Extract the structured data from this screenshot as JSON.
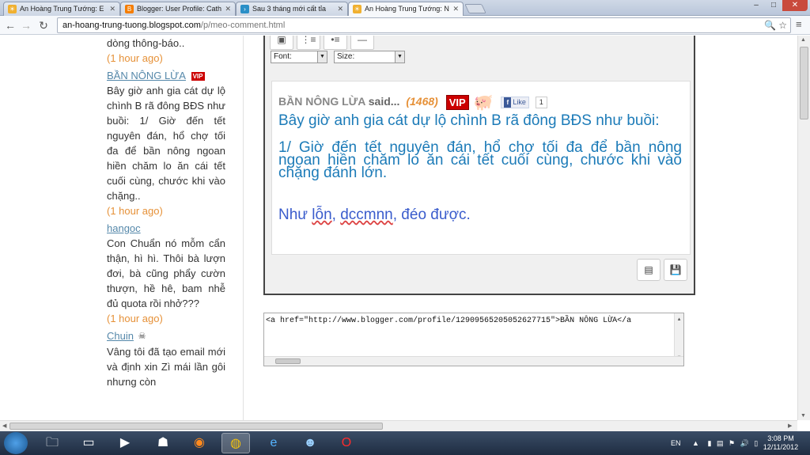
{
  "browser": {
    "tabs": [
      {
        "title": "An Hoàng Trung Tướng: E",
        "icon": "sun-icon",
        "active": false
      },
      {
        "title": "Blogger: User Profile: Cath",
        "icon": "blogger-icon",
        "active": false
      },
      {
        "title": "Sau 3 tháng mới cất tỉa",
        "icon": "arrow-icon",
        "active": false
      },
      {
        "title": "An Hoàng Trung Tướng: N",
        "icon": "sun-icon",
        "active": true
      }
    ],
    "window_controls": {
      "minimize": "–",
      "maximize": "□",
      "close": "✕"
    },
    "url_host": "an-hoang-trung-tuong.blogspot.com",
    "url_path": "/p/meo-comment.html"
  },
  "sidebar": {
    "intro_text": "dòng thông-báo..",
    "intro_time": "(1 hour ago)",
    "comments": [
      {
        "author": "BẦN NÔNG LỪA",
        "badge": "VIP",
        "text": "Bây giờ anh gia cát dự lộ chình B rã đông BĐS như buồi: 1/ Giờ đến tết nguyên đán, hổ chợ tối đa để bần nông ngoan hiền chăm lo ăn cái tết cuối cùng, chước khi vào chặng..",
        "time": "(1 hour ago)"
      },
      {
        "author": "hangoc",
        "badge": "",
        "text": "Con Chuẩn nó mỗm cẩn thận, hì hì. Thôi bà lượn đơi, bà cũng phẩy cườn thượn, hề hê, bam nhễ đủ quota rồi nhở???",
        "time": "(1 hour ago)"
      },
      {
        "author": "Chuin",
        "badge": "☠",
        "text": "Vâng tôi đã tạo email mới và định xin Zì mái lần gôi nhưng còn",
        "time": ""
      }
    ]
  },
  "editor": {
    "toolbar_icons": [
      "insert-image-icon",
      "ordered-list-icon",
      "unordered-list-icon",
      "horizontal-rule-icon"
    ],
    "font_select": "Font:",
    "size_select": "Size:",
    "preview": {
      "author": "BẦN NÔNG LỪA",
      "said": "said...",
      "count": "(1468)",
      "vip": "VIP",
      "like_label": "Like",
      "like_count": "1",
      "para1": "Bây giờ anh gia cát dự lộ chình B rã đông BĐS như buồi:",
      "para2": "1/ Giờ đến tết nguyên đán, hổ chợ tối đa để bần nông ngoan hiền chăm lo ăn cái tết cuối cùng, chước khi vào chặng đánh lớn.",
      "last_prefix": "Như ",
      "last_w1": "lỗn",
      "last_comma": ", ",
      "last_w2": "dccmnn",
      "last_suffix": ", đéo được."
    },
    "code_text": "<a href=\"http://www.blogger.com/profile/12909565205052627715\">BẦN NÔNG LỪA</a"
  },
  "taskbar": {
    "apps": [
      "folder-icon",
      "library-icon",
      "media-player-icon",
      "network-icon",
      "firefox-icon",
      "chrome-icon",
      "ie-icon",
      "messenger-icon",
      "opera-icon"
    ],
    "language": "EN",
    "time": "3:08 PM",
    "date": "12/11/2012"
  }
}
